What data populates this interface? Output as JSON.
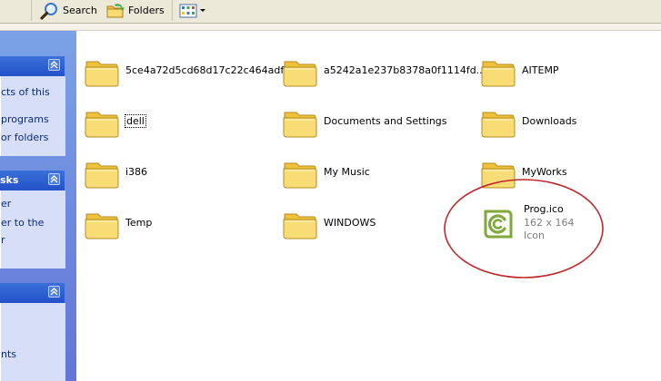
{
  "toolbar": {
    "search_label": "Search",
    "folders_label": "Folders"
  },
  "taskpane": {
    "sections": [
      {
        "header": "",
        "links": [
          "cts of this",
          "programs",
          "or folders"
        ]
      },
      {
        "header": "sks",
        "links": [
          "er",
          "er to the",
          "r"
        ]
      },
      {
        "header": "",
        "links": [
          "nts"
        ]
      }
    ]
  },
  "items": [
    {
      "name": "5ce4a72d5cd68d17c22c464adf",
      "type": "folder"
    },
    {
      "name": "a5242a1e237b8378a0f1114fd...",
      "type": "folder"
    },
    {
      "name": "AITEMP",
      "type": "folder"
    },
    {
      "name": "dell",
      "type": "folder",
      "focused": true
    },
    {
      "name": "Documents and Settings",
      "type": "folder"
    },
    {
      "name": "Downloads",
      "type": "folder"
    },
    {
      "name": "i386",
      "type": "folder"
    },
    {
      "name": "My Music",
      "type": "folder"
    },
    {
      "name": "MyWorks",
      "type": "folder"
    },
    {
      "name": "Temp",
      "type": "folder"
    },
    {
      "name": "WINDOWS",
      "type": "folder"
    },
    {
      "name": "Prog.ico",
      "type": "file",
      "dimensions": "162 x 164",
      "filetype": "Icon",
      "icon": "prog-icon"
    }
  ],
  "colors": {
    "folder_body": "#f4d35f",
    "folder_tab": "#f0c23a",
    "taskpane_header": "#2352c8",
    "annotation_circle": "#c0272d",
    "prog_icon": "#7fa93a"
  }
}
